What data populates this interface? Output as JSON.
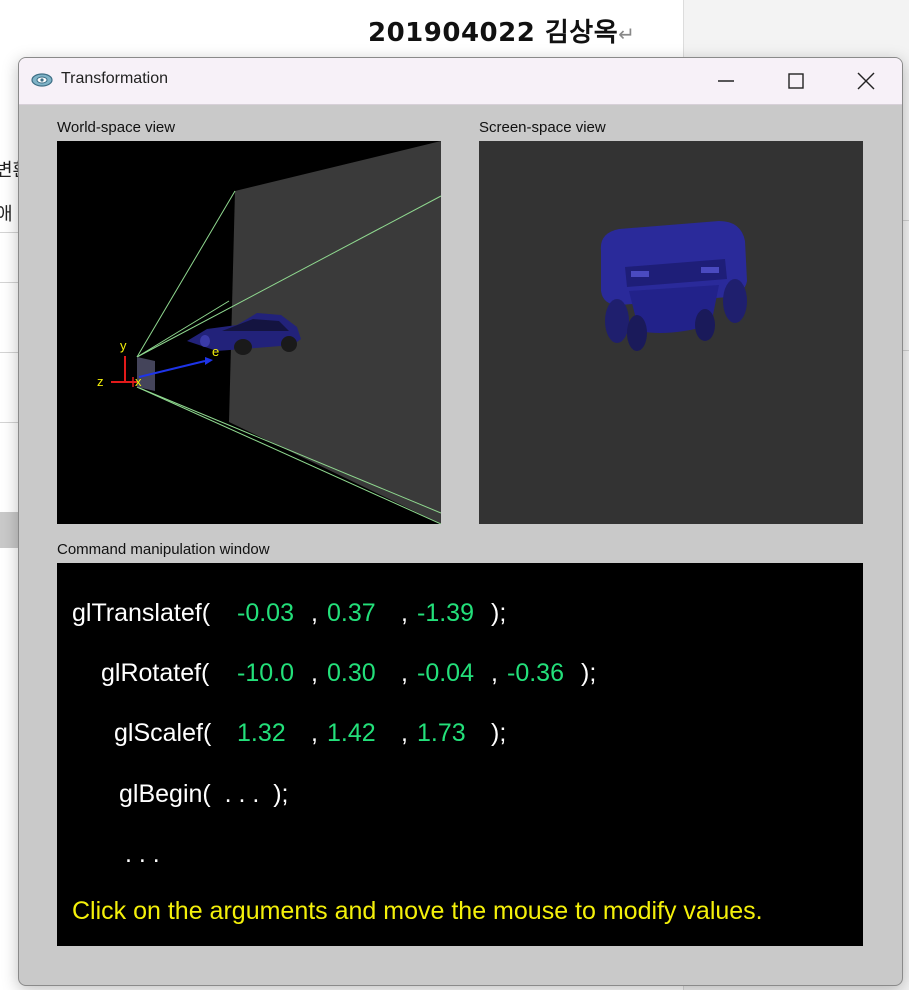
{
  "document": {
    "title": "201904022  김상옥",
    "return_mark": "↵",
    "side_fragments": [
      "변환",
      "애"
    ]
  },
  "window": {
    "title": "Transformation",
    "controls": {
      "minimize": "minimize-icon",
      "maximize": "maximize-icon",
      "close": "close-icon"
    }
  },
  "world_view": {
    "label": "World-space view",
    "axis_labels": {
      "y": "y",
      "z": "z",
      "x": "x",
      "e": "e"
    }
  },
  "screen_view": {
    "label": "Screen-space view"
  },
  "command_window": {
    "label": "Command manipulation window",
    "translate": {
      "func": "glTranslatef(",
      "args": [
        "-0.03",
        "0.37",
        "-1.39"
      ],
      "end": ");"
    },
    "rotate": {
      "func": "glRotatef(",
      "args": [
        "-10.0",
        "0.30",
        "-0.04",
        "-0.36"
      ],
      "end": ");"
    },
    "scale": {
      "func": "glScalef(",
      "args": [
        "1.32",
        "1.42",
        "1.73"
      ],
      "end": ");"
    },
    "begin": {
      "text": "glBegin(  . . .  );"
    },
    "ellipsis": ". . .",
    "hint": "Click on the arguments and move the mouse to modify values."
  },
  "colors": {
    "arg_green": "#23e07a",
    "hint_yellow": "#f4f00a",
    "frustum_green": "#8fd88f",
    "car_blue": "#2a2a9a",
    "panel_gray": "#333333"
  }
}
